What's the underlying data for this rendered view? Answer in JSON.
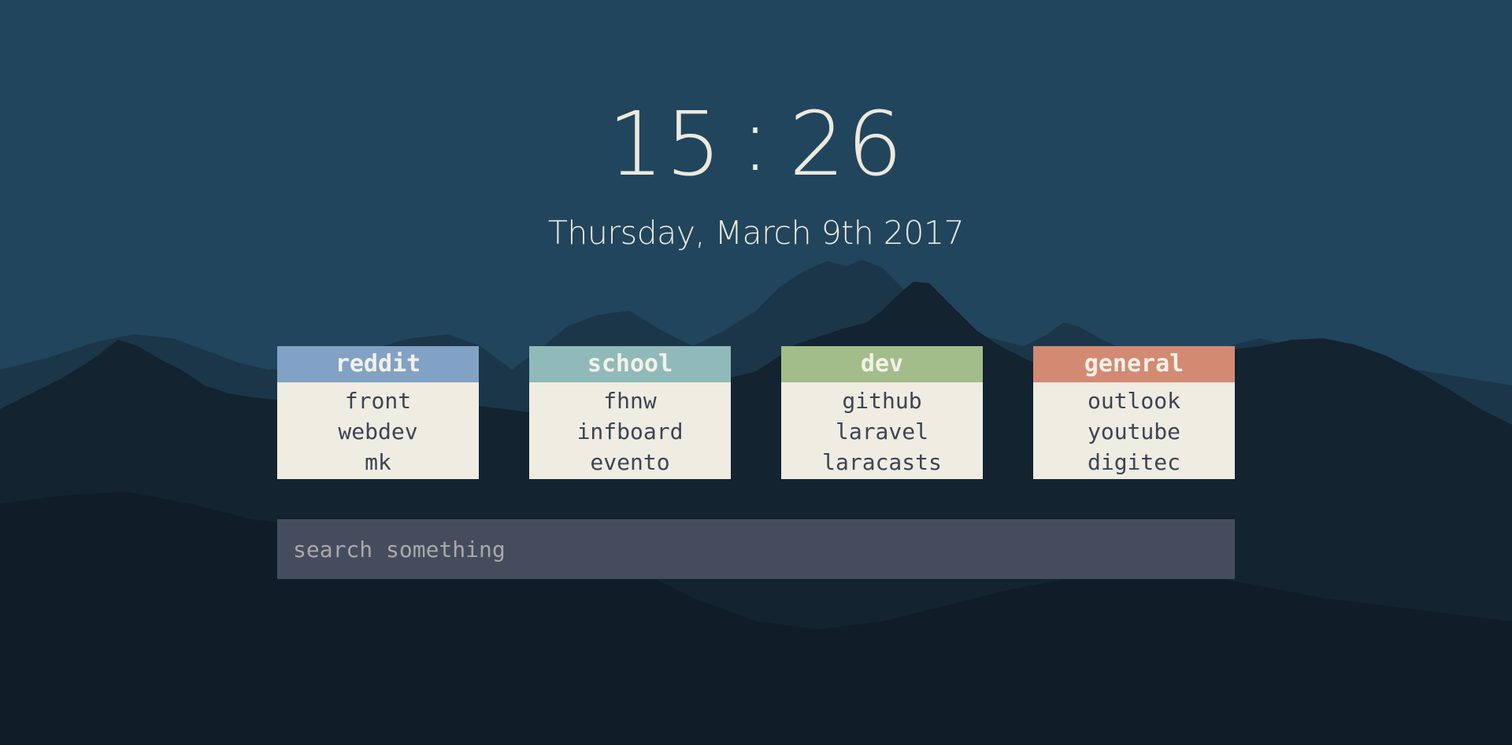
{
  "colors": {
    "sky": "#21455d",
    "mountain_far": "#1a3447",
    "mountain_near": "#111e29",
    "text_light": "#ece9dd",
    "box_body": "#efece2",
    "link_text": "#3c4454",
    "search_bg": "#454c5e"
  },
  "clock": {
    "hours": "15",
    "separator": ":",
    "minutes": "26"
  },
  "date": "Thursday, March 9th 2017",
  "bookmark_groups": [
    {
      "title": "reddit",
      "color": "#81a2c5",
      "links": [
        "front",
        "webdev",
        "mk"
      ]
    },
    {
      "title": "school",
      "color": "#90bab9",
      "links": [
        "fhnw",
        "infboard",
        "evento"
      ]
    },
    {
      "title": "dev",
      "color": "#a3bd8a",
      "links": [
        "github",
        "laravel",
        "laracasts"
      ]
    },
    {
      "title": "general",
      "color": "#d38a73",
      "links": [
        "outlook",
        "youtube",
        "digitec"
      ]
    }
  ],
  "search": {
    "placeholder": "search something",
    "value": ""
  }
}
